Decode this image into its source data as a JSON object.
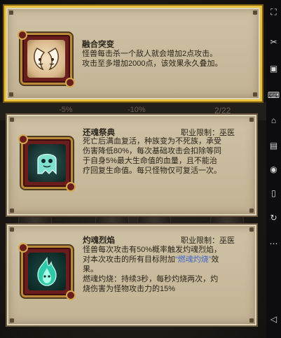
{
  "background": {
    "left_value": "-5%",
    "mid_value": "-10%",
    "right_value": "2/22"
  },
  "cards": [
    {
      "title": "融合突变",
      "icon": "twin-spirits-icon",
      "lines": [
        "怪兽每击杀一个敌人就会增加2点攻击。",
        "攻击至多增加2000点，该效果永久叠加。"
      ]
    },
    {
      "restriction": "职业限制：巫医",
      "title": "还魂祭典",
      "icon": "ghost-icon",
      "lines": [
        "死亡后满血复活，种族变为不死族，承受",
        "伤害降低80%，每次基础攻击会扣除等同",
        "于自身5%最大生命值的血量，且不能治",
        "疗回复生命值。每只怪物仅可复活一次。"
      ]
    },
    {
      "restriction": "职业限制：巫医",
      "title": "灼魂烈焰",
      "icon": "soul-flame-icon",
      "lines_a": [
        "怪兽每次攻击有50%概率触发灼魂烈焰，",
        "对本次攻击的所有目标附加"
      ],
      "highlight": "“燃魂灼烧”",
      "lines_b": "效",
      "line_c": "果。",
      "lines_d": [
        "燃魂灼烧：持续3秒，每秒灼烧两次，灼",
        "烧伤害为怪物攻击力的15%"
      ]
    }
  ],
  "toolbar": {
    "icons": [
      "screenshot-icon",
      "scissors-icon",
      "record-icon",
      "keyboard-icon",
      "tag-icon",
      "layers-icon",
      "location-icon",
      "phone-icon",
      "rotate-icon",
      "more-icon",
      "back-icon"
    ]
  },
  "colors": {
    "card_bg": "#c9bb9c",
    "selected_border": "#e8c23b",
    "highlight_text": "#3f66c9"
  }
}
